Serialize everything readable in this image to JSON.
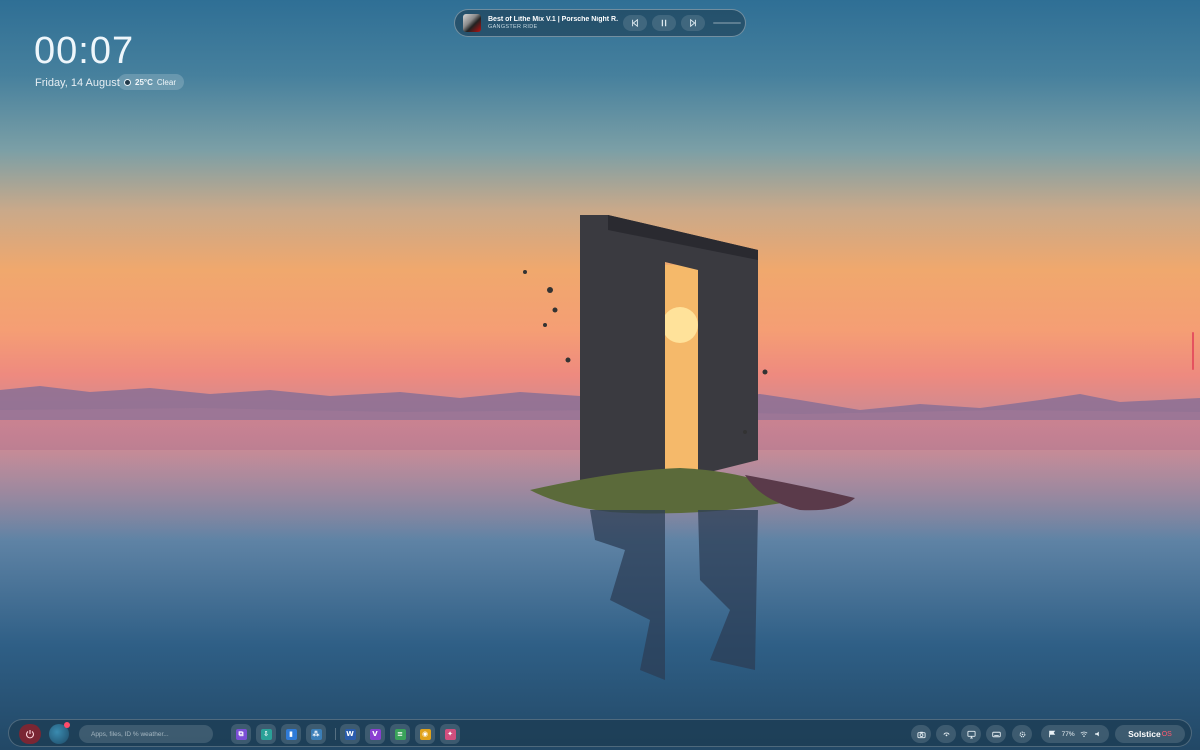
{
  "clock": {
    "time": "00:07",
    "date": "Friday, 14 August"
  },
  "weather": {
    "temperature": "25°C",
    "condition": "Clear",
    "icon": "moon-icon"
  },
  "media": {
    "track": "Best of Lithe Mix V.1 | Porsche Night R...",
    "artist": "GANGSTER RIDE",
    "progress": 0.0,
    "controls": [
      "previous-icon",
      "pause-icon",
      "next-icon"
    ]
  },
  "taskbar": {
    "search_placeholder": "Apps, files, ID % weather...",
    "apps": [
      {
        "name": "visual-studio",
        "icon": "visual-studio-icon",
        "color": "#7b4fd6",
        "letter": "⧉"
      },
      {
        "name": "app-installer",
        "icon": "installer-icon",
        "color": "#2aa198",
        "letter": "⇩"
      },
      {
        "name": "azure-data-studio",
        "icon": "chart-icon",
        "color": "#2f7bd8",
        "letter": "▮"
      },
      {
        "name": "network-tool",
        "icon": "network-icon",
        "color": "#3b7fb8",
        "letter": "⁂"
      },
      {
        "name": "word",
        "icon": "word-icon",
        "color": "#2b5cad",
        "letter": "W"
      },
      {
        "name": "visual-studio-purple",
        "icon": "vs-icon",
        "color": "#8a3fd1",
        "letter": "V"
      },
      {
        "name": "notepad",
        "icon": "notepad-icon",
        "color": "#3aa35a",
        "letter": "≡"
      },
      {
        "name": "chrome",
        "icon": "chrome-icon",
        "color": "#e0a21a",
        "letter": "◉"
      },
      {
        "name": "copilot",
        "icon": "copilot-icon",
        "color": "#d14f7e",
        "letter": "✦"
      }
    ],
    "tray": [
      "camera-icon",
      "broadcast-icon",
      "display-icon",
      "keyboard-icon",
      "settings-icon"
    ],
    "status": {
      "battery": "77%",
      "wifi_icon": "wifi-icon",
      "volume_icon": "volume-icon",
      "flag_icon": "flag-icon"
    },
    "brand": {
      "name": "Solstice",
      "suffix": "OS"
    }
  },
  "colors": {
    "accent": "#e5525f",
    "power": "#7a2633"
  }
}
